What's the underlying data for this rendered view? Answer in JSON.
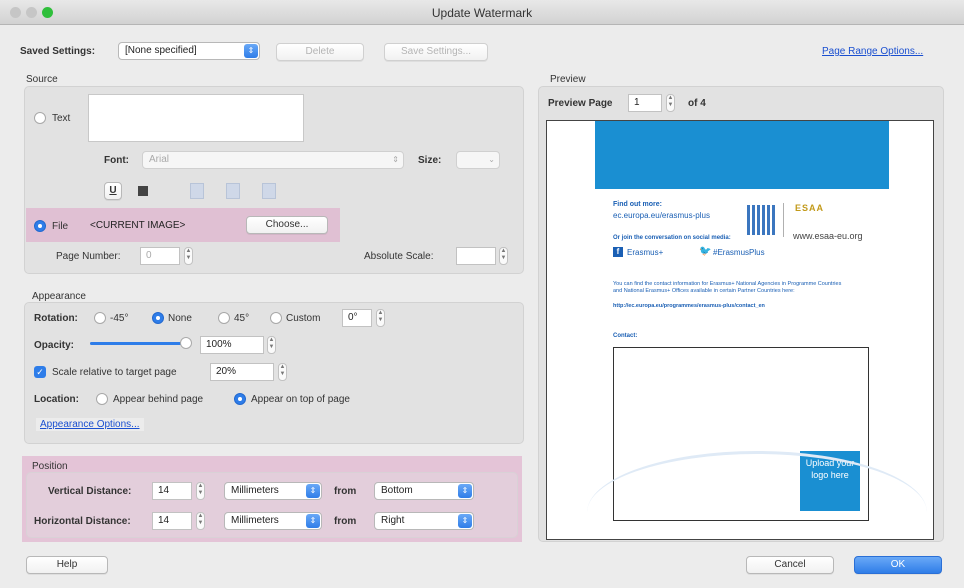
{
  "window": {
    "title": "Update Watermark"
  },
  "top": {
    "saved_settings_label": "Saved Settings:",
    "saved_settings_value": "[None specified]",
    "delete_label": "Delete",
    "save_settings_label": "Save Settings...",
    "page_range_options_label": "Page Range Options..."
  },
  "source": {
    "section_title": "Source",
    "text_option": "Text",
    "font_label": "Font:",
    "font_value": "Arial",
    "size_label": "Size:",
    "underline_label": "U",
    "file_option": "File",
    "file_value": "<CURRENT IMAGE>",
    "choose_label": "Choose...",
    "page_number_label": "Page Number:",
    "page_number_value": "0",
    "absolute_scale_label": "Absolute Scale:"
  },
  "appearance": {
    "section_title": "Appearance",
    "rotation_label": "Rotation:",
    "rotation_options": [
      "-45°",
      "None",
      "45°",
      "Custom"
    ],
    "rotation_custom_value": "0°",
    "opacity_label": "Opacity:",
    "opacity_value": "100%",
    "opacity_fraction": 1.0,
    "scale_label": "Scale relative to target page",
    "scale_value": "20%",
    "location_label": "Location:",
    "location_behind": "Appear behind page",
    "location_top": "Appear on top of page",
    "appearance_options_label": "Appearance Options..."
  },
  "position": {
    "section_title": "Position",
    "vertical_label": "Vertical Distance:",
    "vertical_value": "14",
    "vertical_unit": "Millimeters",
    "vertical_from_label": "from",
    "vertical_from_value": "Bottom",
    "horizontal_label": "Horizontal Distance:",
    "horizontal_value": "14",
    "horizontal_unit": "Millimeters",
    "horizontal_from_label": "from",
    "horizontal_from_value": "Right"
  },
  "preview": {
    "section_title": "Preview",
    "preview_page_label": "Preview Page",
    "preview_page_value": "1",
    "of_label": "of 4",
    "doc": {
      "find_out_more": "Find out more:",
      "url": "ec.europa.eu/erasmus-plus",
      "join": "Or join the conversation on social media:",
      "facebook": "Erasmus+",
      "twitter": "#ErasmusPlus",
      "esaa_logo": "ESAA",
      "esaa_site": "www.esaa-eu.org",
      "info_text": "You can find the contact information for Erasmus+ National Agencies in Programme Countries and National Erasmus+ Offices available in certain Partner Countries here:",
      "info_link": "http://ec.europa.eu/programmes/erasmus-plus/contact_en",
      "contact": "Contact:",
      "upload_logo": "Upload your logo here"
    }
  },
  "bottom": {
    "help_label": "Help",
    "cancel_label": "Cancel",
    "ok_label": "OK"
  },
  "colors": {
    "accent": "#2e7de9",
    "highlight": "#dea4c6",
    "doc_banner": "#1a8fd2",
    "upload_box": "#1a8fd2"
  }
}
